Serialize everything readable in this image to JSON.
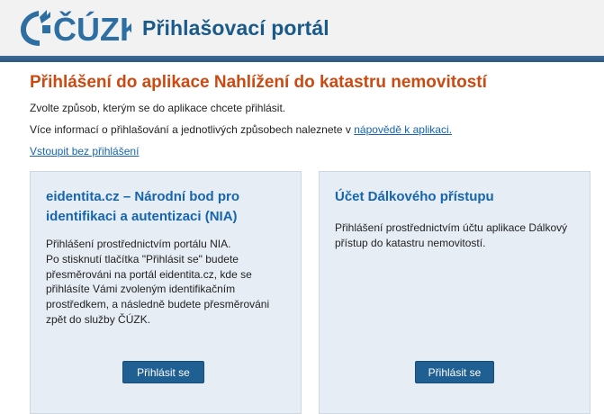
{
  "header": {
    "logo_text": "ČÚZK",
    "title": "Přihlašovací portál"
  },
  "main": {
    "heading": "Přihlášení do aplikace Nahlížení do katastru nemovitostí",
    "intro": "Zvolte způsob, kterým se do aplikace chcete přihlásit.",
    "info_prefix": "Více informací o přihlašování a jednotlivých způsobech naleznete v ",
    "info_link": "nápovědě k aplikaci.",
    "guest_link": "Vstoupit bez přihlášení"
  },
  "cards": [
    {
      "title": "eidentita.cz – Národní bod pro identifikaci a autentizaci (NIA)",
      "text": "Přihlášení prostřednictvím portálu NIA.\nPo stisknutí tlačítka \"Přihlásit se\" budete přesměrováni na portál eidentita.cz, kde se přihlásíte Vámi zvoleným identifikačním prostředkem, a následně budete přesměrováni zpět do služby ČÚZK.",
      "button": "Přihlásit se"
    },
    {
      "title": "Účet Dálkového přístupu",
      "text": "Přihlášení prostřednictvím účtu aplikace Dálkový přístup do katastru nemovitostí.",
      "button": "Přihlásit se"
    }
  ],
  "colors": {
    "heading": "#cc4a12",
    "link": "#1565b0",
    "card_background": "#e6edf4",
    "button": "#1f5f92",
    "header_stripe": "#2d5880"
  }
}
